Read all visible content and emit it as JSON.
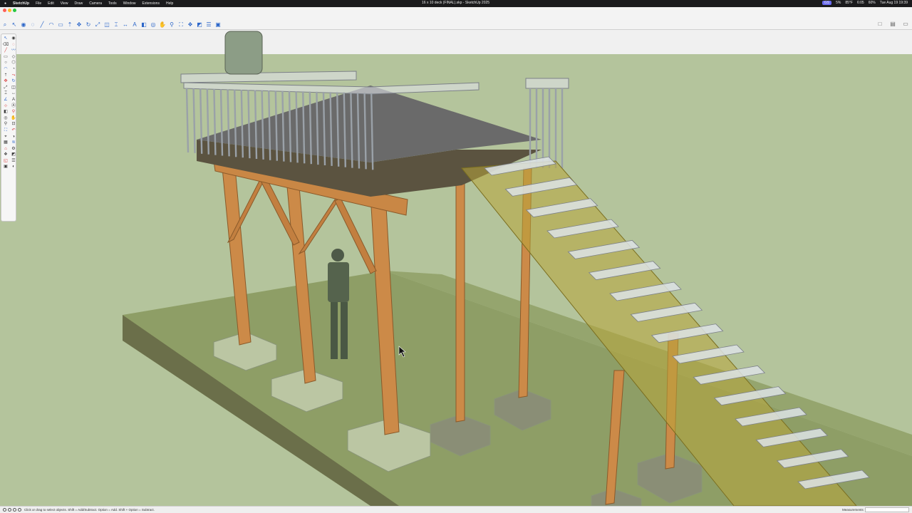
{
  "menubar": {
    "apple": "",
    "app_name": "SketchUp",
    "menus": [
      "File",
      "Edit",
      "View",
      "Draw",
      "Camera",
      "Tools",
      "Window",
      "Extensions",
      "Help"
    ],
    "center_title": "16 x 10 deck (FINAL).skp - SketchUp 2025",
    "status": {
      "wifi_pill": "GS",
      "cpu": "5%",
      "weather": "85°F",
      "clock1": "6:05",
      "battery": "60%",
      "datetime": "Tue Aug 19 19:39"
    }
  },
  "window": {
    "document_title": "16 x 10 deck (FINAL).skp - SketchUp 2025"
  },
  "toolbar": {
    "tools": [
      "search-icon",
      "select-icon",
      "paint-bucket-icon",
      "lasso-icon",
      "line-icon",
      "arc-icon",
      "rectangle-icon",
      "push-pull-icon",
      "move-icon",
      "rotate-icon",
      "scale-icon",
      "offset-icon",
      "tape-measure-icon",
      "dimension-icon",
      "text-icon",
      "section-plane-icon",
      "orbit-icon",
      "pan-icon",
      "zoom-icon",
      "zoom-extents-icon",
      "components-icon",
      "styles-icon",
      "layers-icon",
      "scenes-icon"
    ]
  },
  "status_bar": {
    "hint": "Click or drag to select objects. Shift = Add/Subtract. Option = Add. Shift + Option = Subtract.",
    "measurements_label": "Measurements"
  },
  "colors": {
    "sky": "#b9c9a3",
    "ground": "#8a9a63",
    "timber": "#c98745",
    "stair_stringer": "#a89a3a",
    "railing": "#d8dde2",
    "accent": "#2d67c9"
  }
}
